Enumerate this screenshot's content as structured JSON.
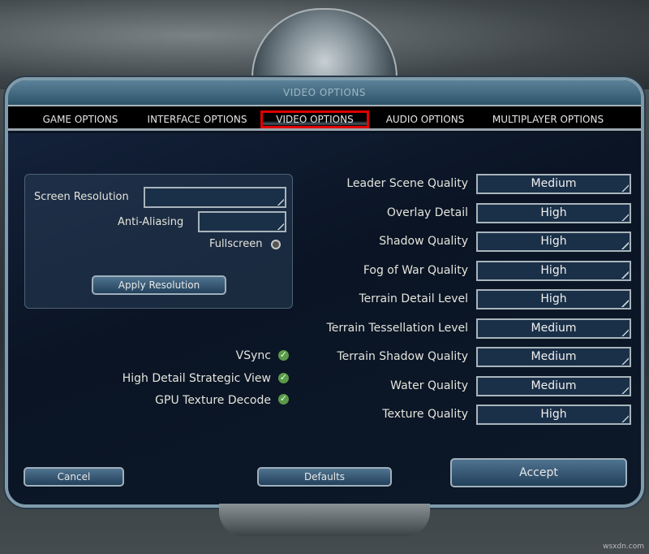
{
  "window": {
    "title": "VIDEO OPTIONS"
  },
  "tabs": [
    {
      "label": "GAME OPTIONS"
    },
    {
      "label": "INTERFACE OPTIONS"
    },
    {
      "label": "VIDEO OPTIONS",
      "active": true
    },
    {
      "label": "AUDIO OPTIONS"
    },
    {
      "label": "MULTIPLAYER OPTIONS"
    }
  ],
  "resolution": {
    "screen_resolution_label": "Screen Resolution",
    "screen_resolution_value": "",
    "anti_aliasing_label": "Anti-Aliasing",
    "anti_aliasing_value": "",
    "fullscreen_label": "Fullscreen",
    "fullscreen_checked": false,
    "apply_label": "Apply Resolution"
  },
  "checkboxes": [
    {
      "label": "VSync",
      "checked": true
    },
    {
      "label": "High Detail Strategic View",
      "checked": true
    },
    {
      "label": "GPU Texture Decode",
      "checked": true
    }
  ],
  "settings": [
    {
      "label": "Leader Scene Quality",
      "value": "Medium"
    },
    {
      "label": "Overlay Detail",
      "value": "High"
    },
    {
      "label": "Shadow Quality",
      "value": "High"
    },
    {
      "label": "Fog of War Quality",
      "value": "High"
    },
    {
      "label": "Terrain Detail Level",
      "value": "High"
    },
    {
      "label": "Terrain Tessellation Level",
      "value": "Medium"
    },
    {
      "label": "Terrain Shadow Quality",
      "value": "Medium"
    },
    {
      "label": "Water Quality",
      "value": "Medium"
    },
    {
      "label": "Texture Quality",
      "value": "High"
    }
  ],
  "buttons": {
    "cancel": "Cancel",
    "defaults": "Defaults",
    "accept": "Accept"
  },
  "colors": {
    "highlight": "#e00000",
    "checkbox": "#5a9a4a"
  },
  "watermark": "wsxdn.com"
}
